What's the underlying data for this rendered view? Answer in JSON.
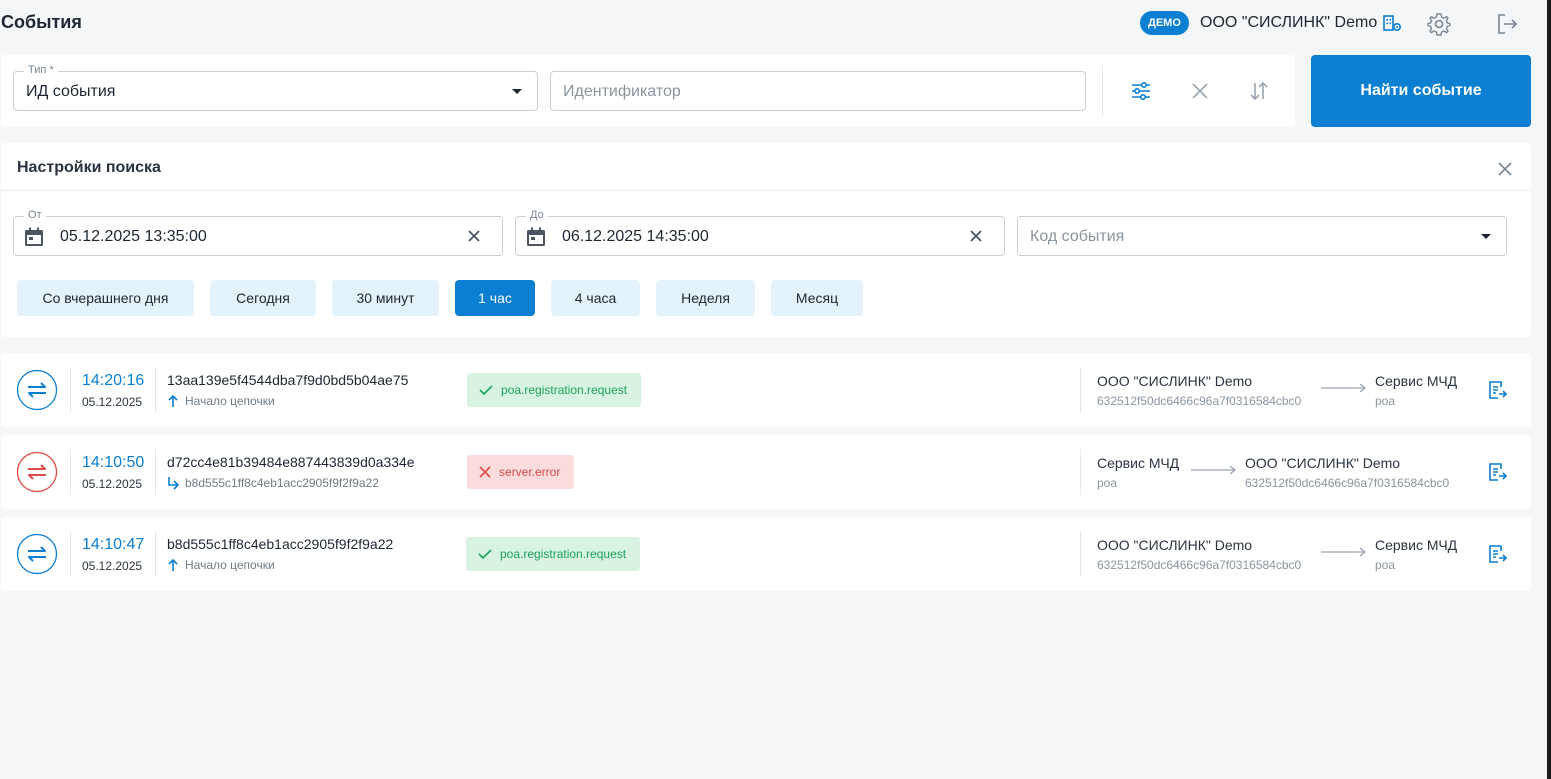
{
  "header": {
    "title": "События",
    "badge": "ДЕМО",
    "org": "ООО \"СИСЛИНК\" Demo"
  },
  "search": {
    "type_label": "Тип *",
    "type_value": "ИД события",
    "identifier_placeholder": "Идентификатор",
    "find_button": "Найти событие"
  },
  "settings": {
    "title": "Настройки поиска",
    "from_label": "От",
    "from_value": "05.12.2025 13:35:00",
    "to_label": "До",
    "to_value": "06.12.2025 14:35:00",
    "event_code_placeholder": "Код события",
    "presets": [
      "Со вчерашнего дня",
      "Сегодня",
      "30 минут",
      "1 час",
      "4 часа",
      "Неделя",
      "Месяц"
    ],
    "active_preset": "1 час"
  },
  "events": [
    {
      "status": "ok",
      "time": "14:20:16",
      "date": "05.12.2025",
      "id": "13aa139e5f4544dba7f9d0bd5b04ae75",
      "chain": "Начало цепочки",
      "chain_icon": "arrow-up-icon",
      "tag": "poa.registration.request",
      "from_name": "ООО \"СИСЛИНК\" Demo",
      "from_sub": "632512f50dc6466c96a7f0316584cbc0",
      "to_name": "Сервис МЧД",
      "to_sub": "poa"
    },
    {
      "status": "err",
      "time": "14:10:50",
      "date": "05.12.2025",
      "id": "d72cc4e81b39484e887443839d0a334e",
      "chain": "b8d555c1ff8c4eb1acc2905f9f2f9a22",
      "chain_icon": "reply-arrow-icon",
      "tag": "server.error",
      "from_name": "Сервис МЧД",
      "from_sub": "poa",
      "to_name": "ООО \"СИСЛИНК\" Demo",
      "to_sub": "632512f50dc6466c96a7f0316584cbc0"
    },
    {
      "status": "ok",
      "time": "14:10:47",
      "date": "05.12.2025",
      "id": "b8d555c1ff8c4eb1acc2905f9f2f9a22",
      "chain": "Начало цепочки",
      "chain_icon": "arrow-up-icon",
      "tag": "poa.registration.request",
      "from_name": "ООО \"СИСЛИНК\" Demo",
      "from_sub": "632512f50dc6466c96a7f0316584cbc0",
      "to_name": "Сервис МЧД",
      "to_sub": "poa"
    }
  ],
  "colors": {
    "accent": "#0b7fd1",
    "success": "#1aa35a",
    "error": "#e14a4a"
  }
}
